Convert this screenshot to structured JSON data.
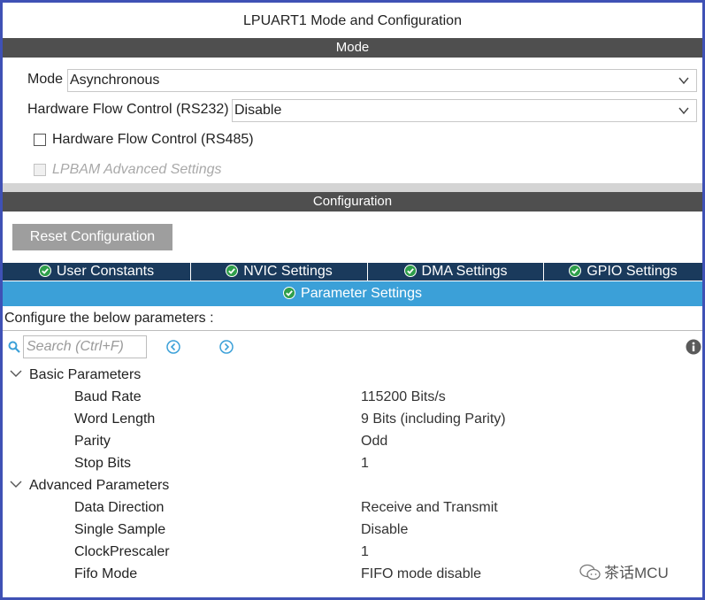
{
  "window": {
    "title": "LPUART1 Mode and Configuration"
  },
  "mode_section": {
    "header": "Mode",
    "mode_label": "Mode",
    "mode_value": "Asynchronous",
    "hw_flow_label": "Hardware Flow Control (RS232)",
    "hw_flow_value": "Disable",
    "rs485_label": "Hardware Flow Control (RS485)",
    "rs485_checked": false,
    "lpbam_label": "LPBAM Advanced Settings",
    "lpbam_checked": false,
    "lpbam_disabled": true
  },
  "config_section": {
    "header": "Configuration",
    "reset_label": "Reset Configuration",
    "tabs": [
      {
        "label": "User Constants"
      },
      {
        "label": "NVIC Settings"
      },
      {
        "label": "DMA Settings"
      },
      {
        "label": "GPIO Settings"
      }
    ],
    "active_tab": "Parameter Settings",
    "instruction": "Configure the below parameters :",
    "search_placeholder": "Search (Ctrl+F)"
  },
  "parameters": {
    "basic": {
      "title": "Basic Parameters",
      "rows": [
        {
          "name": "Baud Rate",
          "value": "115200 Bits/s"
        },
        {
          "name": "Word Length",
          "value": "9 Bits (including Parity)"
        },
        {
          "name": "Parity",
          "value": "Odd"
        },
        {
          "name": "Stop Bits",
          "value": "1"
        }
      ]
    },
    "advanced": {
      "title": "Advanced Parameters",
      "rows": [
        {
          "name": "Data Direction",
          "value": "Receive and Transmit"
        },
        {
          "name": "Single Sample",
          "value": "Disable"
        },
        {
          "name": "ClockPrescaler",
          "value": "1"
        },
        {
          "name": "Fifo Mode",
          "value": "FIFO mode disable"
        }
      ]
    }
  },
  "watermark": {
    "text": "茶话MCU"
  },
  "colors": {
    "frame_border": "#3f51b5",
    "section_header": "#4f4f4f",
    "tab_dark": "#1a3a5c",
    "tab_active": "#3ba0d8",
    "check_green": "#2e9e4a"
  }
}
